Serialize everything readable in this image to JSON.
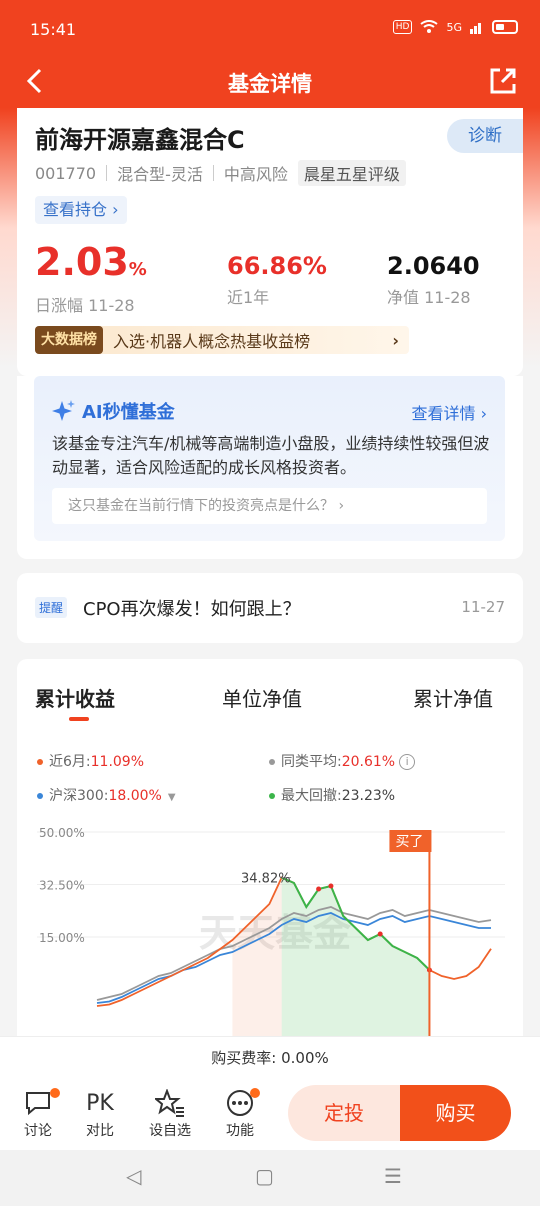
{
  "status": {
    "time": "15:41",
    "hd": "HD",
    "network": "5G"
  },
  "nav": {
    "title": "基金详情",
    "back_icon": "chevron-left-icon",
    "share_icon": "share-icon"
  },
  "fund": {
    "name": "前海开源嘉鑫混合C",
    "diagnose": "诊断",
    "code": "001770",
    "type": "混合型-灵活",
    "risk": "中高风险",
    "rating": "晨星五星评级",
    "holdings": "查看持仓 ›",
    "daily_change": "2.03",
    "daily_change_unit": "%",
    "daily_label": "日涨幅 11-28",
    "year_return": "66.86%",
    "year_label": "近1年",
    "nav_value": "2.0640",
    "nav_label": "净值 11-28",
    "rank_badge": "大数据榜",
    "rank_text": "入选·机器人概念热基收益榜"
  },
  "ai": {
    "title": "AI秒懂基金",
    "detail": "查看详情 ›",
    "desc": "该基金专注汽车/机械等高端制造小盘股，业绩持续性较强但波动显著，适合风险适配的成长风格投资者。",
    "question": "这只基金在当前行情下的投资亮点是什么？ ›"
  },
  "news": {
    "tag": "提醒",
    "text": "CPO再次爆发！如何跟上？",
    "date": "11-27"
  },
  "chart": {
    "tabs": [
      "累计收益",
      "单位净值",
      "累计净值"
    ],
    "legend": {
      "fund": {
        "label": "近6月:",
        "value": "11.09%",
        "color": "#f0622a"
      },
      "peer": {
        "label": "同类平均:",
        "value": "20.61%",
        "color": "#999999"
      },
      "hs300": {
        "label": "沪深300:",
        "value": "18.00%",
        "color": "#3a86d8"
      },
      "drawdown": {
        "label": "最大回撤:",
        "value": "23.23%",
        "color": "#3bb54a"
      }
    },
    "buy_label": "买了",
    "peak_label": "34.82%",
    "watermark": "天天基金"
  },
  "chart_data": {
    "type": "line",
    "ylim": [
      0,
      50
    ],
    "yticks": [
      "50.00%",
      "32.50%",
      "15.00%"
    ],
    "series": [
      {
        "name": "近6月",
        "color": "#f0622a",
        "values": [
          -8,
          -7.5,
          -6,
          -4,
          -2,
          0,
          2,
          4,
          6,
          8,
          11,
          14,
          18,
          22,
          26,
          34.82,
          33,
          25,
          31,
          32,
          22,
          18,
          14,
          16,
          12,
          10,
          8,
          4,
          2,
          1,
          2,
          5,
          11.09
        ]
      },
      {
        "name": "同类平均",
        "color": "#999999",
        "values": [
          -6,
          -5,
          -4,
          -2,
          0,
          2,
          3,
          5,
          7,
          9,
          11,
          12,
          14,
          16,
          18,
          21,
          23,
          22,
          24,
          25,
          23,
          22,
          21,
          23,
          24,
          22,
          23,
          24,
          23,
          22,
          21,
          20,
          20.61
        ]
      },
      {
        "name": "沪深300",
        "color": "#3a86d8",
        "values": [
          -7,
          -6.5,
          -5,
          -3,
          -1,
          1,
          2,
          4,
          5,
          7,
          9,
          10,
          12,
          14,
          16,
          19,
          21,
          20,
          22,
          23,
          21,
          20,
          19,
          21,
          22,
          20,
          21,
          22,
          21,
          20,
          19,
          18,
          18.0
        ]
      }
    ],
    "drawdown_range": [
      15,
      27
    ],
    "buy_index": 27
  },
  "fee": {
    "label": "购买费率:",
    "value": "0.00%"
  },
  "bottom": {
    "tools": [
      {
        "label": "讨论",
        "icon": "chat-bubble-icon",
        "badge": true
      },
      {
        "label": "对比",
        "icon": "pk-icon",
        "glyph": "PK",
        "badge": false
      },
      {
        "label": "设自选",
        "icon": "star-add-icon",
        "badge": false
      },
      {
        "label": "功能",
        "icon": "more-circle-icon",
        "badge": true
      }
    ],
    "dingtou": "定投",
    "buy": "购买"
  },
  "sysnav": {
    "back": "◁",
    "home": "▢",
    "menu": "☰"
  }
}
